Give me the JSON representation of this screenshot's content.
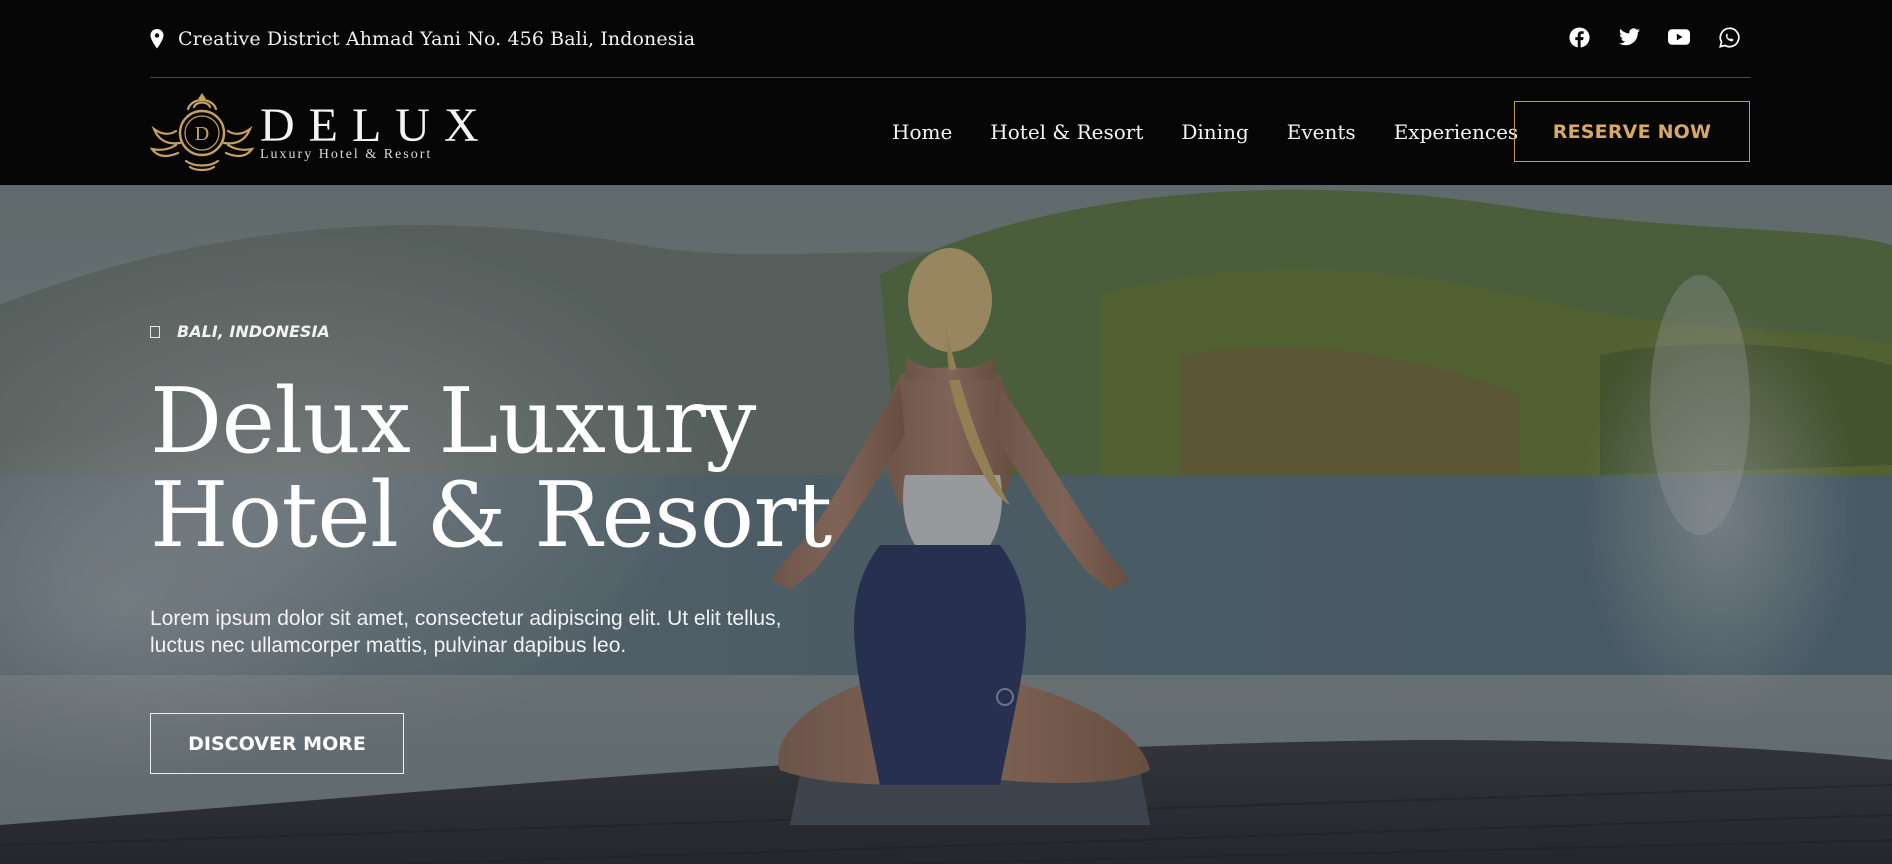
{
  "topbar": {
    "address": "Creative District Ahmad Yani No. 456 Bali, Indonesia",
    "address_icon": "map-pin-icon",
    "socials": [
      {
        "name": "facebook",
        "icon": "facebook-icon"
      },
      {
        "name": "twitter",
        "icon": "twitter-icon"
      },
      {
        "name": "youtube",
        "icon": "youtube-icon"
      },
      {
        "name": "whatsapp",
        "icon": "whatsapp-icon"
      }
    ]
  },
  "logo": {
    "monogram": "D",
    "brand": "DELUX",
    "tagline": "Luxury Hotel & Resort",
    "gold": "#c9a15f"
  },
  "nav": {
    "items": [
      "Home",
      "Hotel & Resort",
      "Dining",
      "Events",
      "Experiences"
    ],
    "cta": "RESERVE NOW"
  },
  "hero": {
    "location": "BALI, INDONESIA",
    "title_line1": "Delux Luxury",
    "title_line2": "Hotel & Resort",
    "description": "Lorem ipsum dolor sit amet, consectetur adipiscing elit. Ut elit tellus, luctus nec ullamcorper mattis, pulvinar dapibus leo.",
    "button": "DISCOVER MORE"
  },
  "colors": {
    "background": "#060606",
    "accent": "#d8a866",
    "text": "#ffffff"
  }
}
